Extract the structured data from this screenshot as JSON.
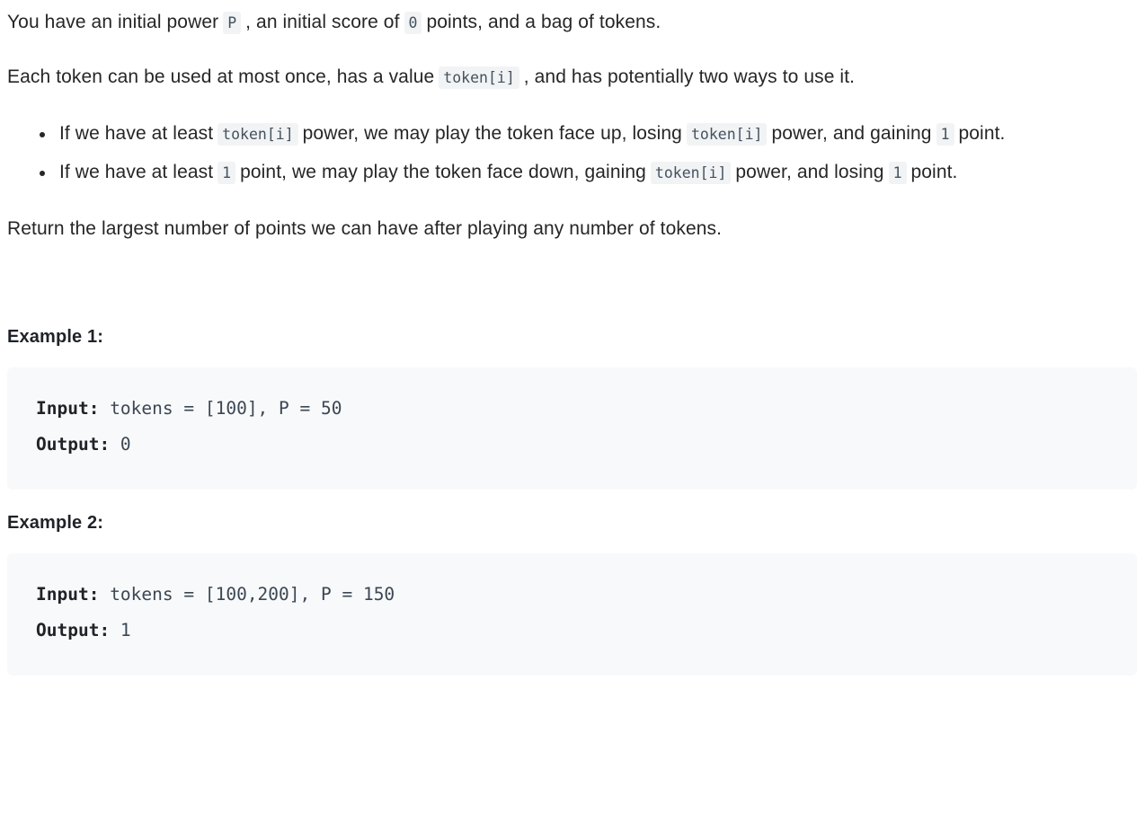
{
  "document": {
    "intro": {
      "part1": "You have an initial power",
      "code_power": "P",
      "part2": ", an initial score of",
      "code_zero": "0",
      "part3": "points, and a bag of tokens."
    },
    "description": {
      "part1": "Each token can be used at most once, has a value",
      "code_token": "token[i]",
      "part2": ", and has potentially two ways to use it."
    },
    "rules": [
      {
        "part1": "If we have at least",
        "code_a": "token[i]",
        "part2": "power, we may play the token face up, losing",
        "code_b": "token[i]",
        "part3": "power, and gaining",
        "code_c": "1",
        "part4": "point."
      },
      {
        "part1": "If we have at least",
        "code_a": "1",
        "part2": "point, we may play the token face down, gaining",
        "code_b": "token[i]",
        "part3": "power, and losing",
        "code_c": "1",
        "part4": "point."
      }
    ],
    "return_statement": "Return the largest number of points we can have after playing any number of tokens.",
    "examples": [
      {
        "heading": "Example 1:",
        "input_label": "Input:",
        "input_value": " tokens = [100], P = 50",
        "output_label": "Output:",
        "output_value": " 0"
      },
      {
        "heading": "Example 2:",
        "input_label": "Input:",
        "input_value": " tokens = [100,200], P = 150",
        "output_label": "Output:",
        "output_value": " 1"
      }
    ]
  }
}
